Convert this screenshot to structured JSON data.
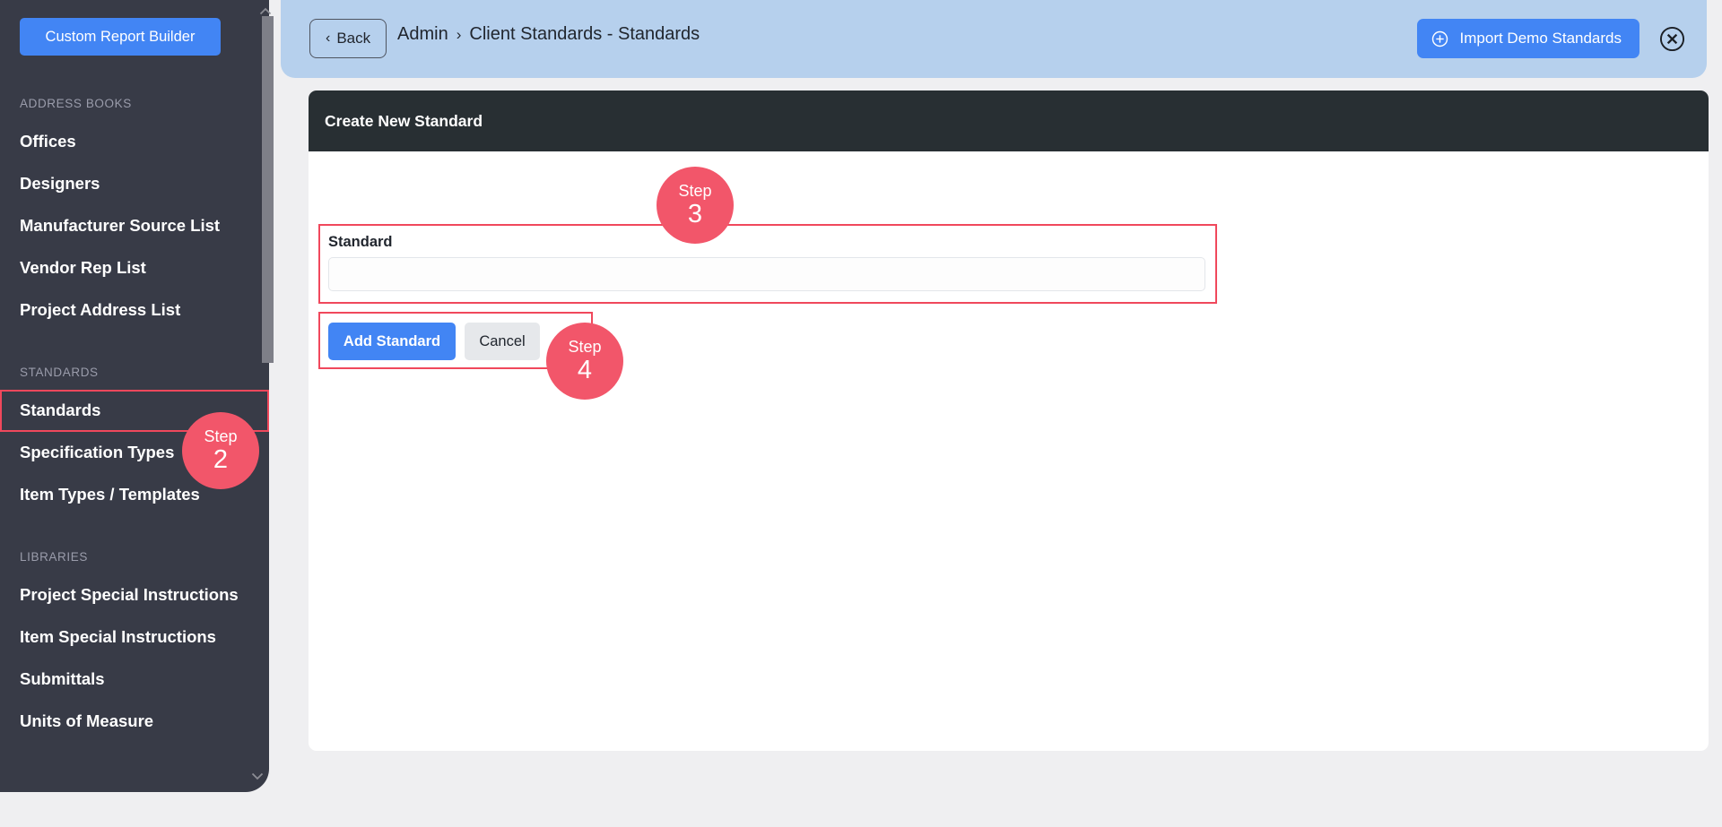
{
  "sidebar": {
    "report_button": "Custom Report Builder",
    "sections": [
      {
        "label": "ADDRESS BOOKS",
        "items": [
          {
            "label": "Offices"
          },
          {
            "label": "Designers"
          },
          {
            "label": "Manufacturer Source List"
          },
          {
            "label": "Vendor Rep List"
          },
          {
            "label": "Project Address List"
          }
        ]
      },
      {
        "label": "STANDARDS",
        "items": [
          {
            "label": "Standards"
          },
          {
            "label": "Specification Types"
          },
          {
            "label": "Item Types / Templates"
          }
        ]
      },
      {
        "label": "LIBRARIES",
        "items": [
          {
            "label": "Project Special Instructions"
          },
          {
            "label": "Item Special Instructions"
          },
          {
            "label": "Submittals"
          },
          {
            "label": "Units of Measure"
          }
        ]
      }
    ]
  },
  "header": {
    "back_label": "Back",
    "back_icon": "chevron-left-icon",
    "breadcrumb": {
      "root": "Admin",
      "separator": "›",
      "current": "Client Standards - Standards"
    },
    "import_label": "Import Demo Standards",
    "import_icon": "plus-circle-icon",
    "close_icon": "close-circle-icon"
  },
  "card": {
    "title": "Create New Standard",
    "field": {
      "label": "Standard",
      "value": "",
      "placeholder": ""
    },
    "actions": {
      "submit_label": "Add Standard",
      "cancel_label": "Cancel"
    }
  },
  "steps": [
    {
      "word": "Step",
      "number": "2"
    },
    {
      "word": "Step",
      "number": "3"
    },
    {
      "word": "Step",
      "number": "4"
    }
  ],
  "colors": {
    "sidebar_bg": "#383b47",
    "page_bg": "#efeff1",
    "header_bar": "#b6d0ed",
    "card_header": "#282f33",
    "accent_blue": "#4285f4",
    "highlight_red": "#f0485c",
    "badge_red": "#f2566a"
  }
}
